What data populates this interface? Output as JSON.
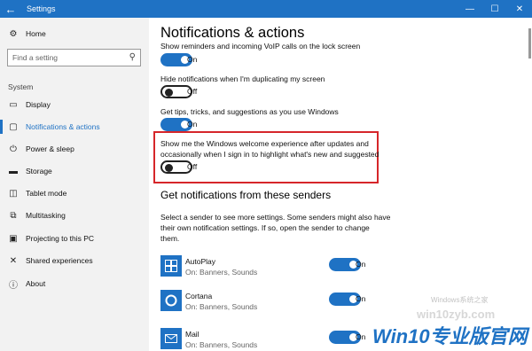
{
  "window": {
    "title": "Settings",
    "back_glyph": "←",
    "minimize_glyph": "—",
    "maximize_glyph": "☐",
    "close_glyph": "✕"
  },
  "sidebar": {
    "home": {
      "label": "Home",
      "icon": "gear-icon"
    },
    "search": {
      "placeholder": "Find a setting",
      "icon": "search-icon"
    },
    "section_label": "System",
    "items": [
      {
        "label": "Display",
        "icon": "display-icon"
      },
      {
        "label": "Notifications & actions",
        "icon": "notifications-icon"
      },
      {
        "label": "Power & sleep",
        "icon": "power-icon"
      },
      {
        "label": "Storage",
        "icon": "storage-icon"
      },
      {
        "label": "Tablet mode",
        "icon": "tablet-mode-icon"
      },
      {
        "label": "Multitasking",
        "icon": "multitasking-icon"
      },
      {
        "label": "Projecting to this PC",
        "icon": "projecting-icon"
      },
      {
        "label": "Shared experiences",
        "icon": "shared-experiences-icon"
      },
      {
        "label": "About",
        "icon": "info-icon"
      }
    ]
  },
  "main": {
    "title": "Notifications & actions",
    "settings": [
      {
        "text": "Show reminders and incoming VoIP calls on the lock screen",
        "state": "On"
      },
      {
        "text": "Hide notifications when I'm duplicating my screen",
        "state": "Off"
      },
      {
        "text": "Get tips, tricks, and suggestions as you use Windows",
        "state": "On"
      },
      {
        "text_line1": "Show me the Windows welcome experience after updates and",
        "text_line2": "occasionally when I sign in to highlight what's new and suggested",
        "state": "Off"
      }
    ],
    "senders_title": "Get notifications from these senders",
    "senders_desc_line1": "Select a sender to see more settings. Some senders might also have",
    "senders_desc_line2": "their own notification settings. If so, open the sender to change",
    "senders_desc_line3": "them.",
    "senders": [
      {
        "name": "AutoPlay",
        "sub": "On: Banners, Sounds",
        "state": "On",
        "icon": "autoplay-icon"
      },
      {
        "name": "Cortana",
        "sub": "On: Banners, Sounds",
        "state": "On",
        "icon": "cortana-icon"
      },
      {
        "name": "Mail",
        "sub": "On: Banners, Sounds",
        "state": "On",
        "icon": "mail-icon"
      }
    ]
  },
  "watermark": {
    "small": "Windows系统之家",
    "url": "win10zyb.com",
    "big": "Win10专业版官网"
  },
  "colors": {
    "accent": "#1f72c4",
    "highlight_border": "#d6262a",
    "sidebar_bg": "#f2f2f2"
  }
}
